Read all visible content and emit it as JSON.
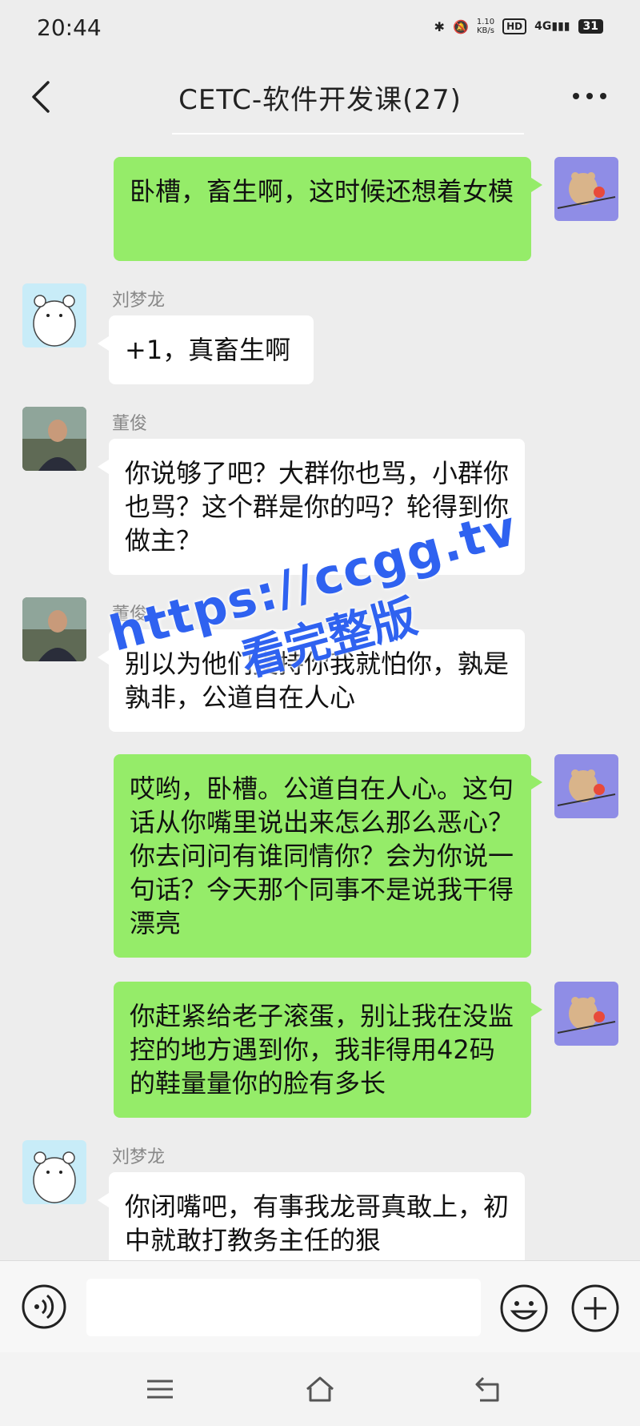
{
  "status_bar": {
    "time": "20:44",
    "net_speed_value": "1.10",
    "net_speed_unit": "KB/s",
    "hd": "HD",
    "signal": "4G",
    "battery": "31"
  },
  "header": {
    "title": "CETC-软件开发课(27)"
  },
  "messages": [
    {
      "side": "right",
      "sender": "",
      "text": "卧槽，畜生啊，这时候还想着女模"
    },
    {
      "side": "left",
      "sender": "刘梦龙",
      "text": "+1，真畜生啊"
    },
    {
      "side": "left",
      "sender": "董俊",
      "text": "你说够了吧？大群你也骂，小群你也骂？这个群是你的吗？轮得到你做主？"
    },
    {
      "side": "left",
      "sender": "董俊",
      "text": "别以为他们支持你我就怕你，孰是孰非，公道自在人心"
    },
    {
      "side": "right",
      "sender": "",
      "text": "哎哟，卧槽。公道自在人心。这句话从你嘴里说出来怎么那么恶心？你去问问有谁同情你？会为你说一句话？今天那个同事不是说我干得漂亮"
    },
    {
      "side": "right",
      "sender": "",
      "text": "你赶紧给老子滚蛋，别让我在没监控的地方遇到你，我非得用42码的鞋量量你的脸有多长"
    },
    {
      "side": "left",
      "sender": "刘梦龙",
      "text": "你闭嘴吧，有事我龙哥真敢上，初中就敢打教务主任的狠"
    }
  ],
  "watermark": {
    "line1": "https://ccgg.tv",
    "line2": "看完整版"
  },
  "colors": {
    "self_bubble": "#95ec69",
    "other_bubble": "#ffffff",
    "background": "#ededed",
    "watermark": "#2f62f0"
  }
}
